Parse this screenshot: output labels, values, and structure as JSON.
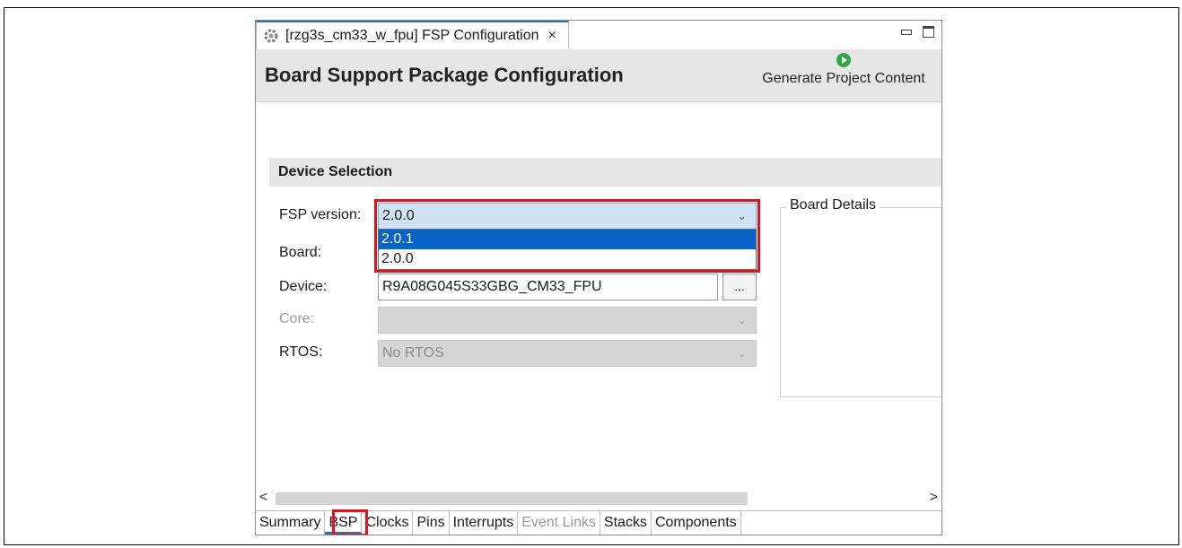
{
  "tab": {
    "title": "[rzg3s_cm33_w_fpu] FSP Configuration",
    "close": "×"
  },
  "header": {
    "title": "Board Support Package Configuration",
    "generate_label": "Generate Project Content"
  },
  "section": {
    "title": "Device Selection"
  },
  "form": {
    "fsp_label": "FSP version:",
    "fsp_value": "2.0.0",
    "fsp_options": [
      "2.0.1",
      "2.0.0"
    ],
    "board_label": "Board:",
    "device_label": "Device:",
    "device_value": "R9A08G045S33GBG_CM33_FPU",
    "browse_label": "...",
    "core_label": "Core:",
    "rtos_label": "RTOS:",
    "rtos_value": "No RTOS"
  },
  "board_details": {
    "legend": "Board Details"
  },
  "scroll": {
    "left": "<",
    "right": ">"
  },
  "bottom_tabs": [
    "Summary",
    "BSP",
    "Clocks",
    "Pins",
    "Interrupts",
    "Event Links",
    "Stacks",
    "Components"
  ],
  "colors": {
    "highlight": "#e0141e",
    "selected": "#0a64c8",
    "accent": "#2f6fb3",
    "run": "#2fa844"
  }
}
